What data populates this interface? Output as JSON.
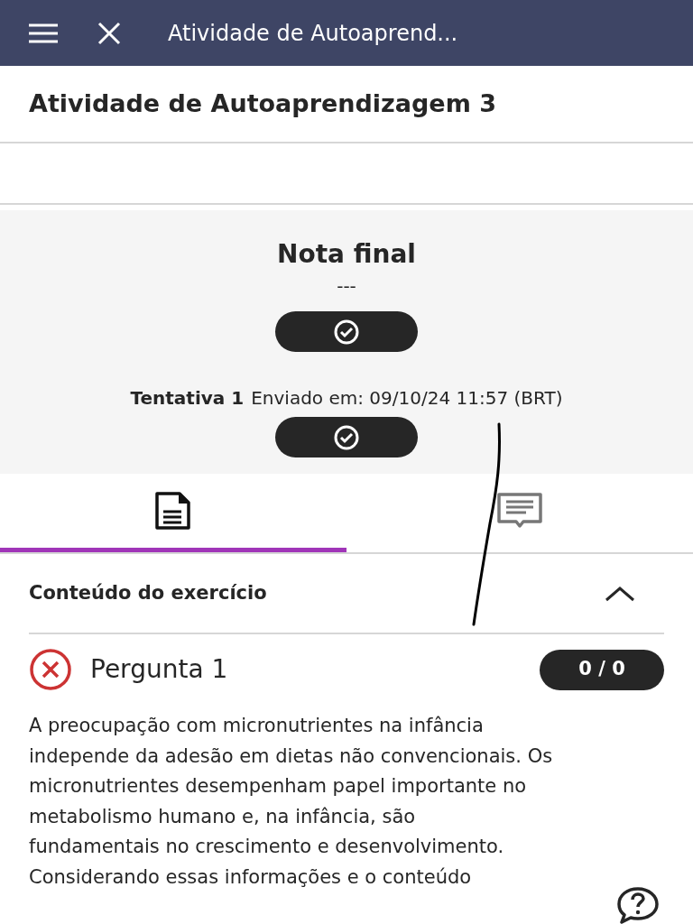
{
  "header": {
    "title": "Atividade de Autoaprend..."
  },
  "page_title": "Atividade de Autoaprendizagem 3",
  "grade": {
    "title": "Nota final",
    "value": "---"
  },
  "attempt": {
    "label": "Tentativa 1",
    "submitted": "Enviado em: 09/10/24 11:57 (BRT)"
  },
  "tabs": [
    {
      "kind": "document",
      "selected": true
    },
    {
      "kind": "comments",
      "selected": false
    }
  ],
  "section": {
    "title": "Conteúdo do exercício",
    "expanded": true
  },
  "question": {
    "title": "Pergunta 1",
    "correct": false,
    "score": "0 / 0",
    "lines": [
      "A preocupação com micronutrientes na infância",
      "independe da adesão em dietas não convencionais. Os",
      "micronutrientes desempenham papel importante no",
      "metabolismo humano e, na infância, são",
      "fundamentais no crescimento e desenvolvimento.",
      "Considerando essas informações e o conteúdo"
    ]
  }
}
